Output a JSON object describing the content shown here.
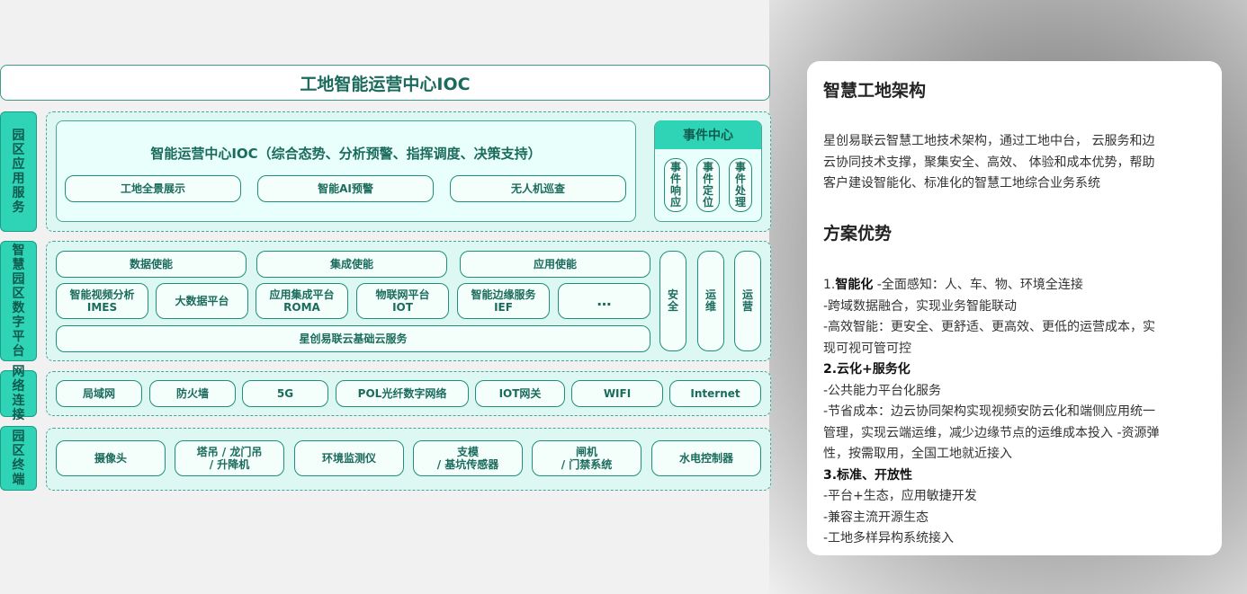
{
  "diagram": {
    "title": "工地智能运营中心IOC",
    "sides": [
      "园区应用服务",
      "智慧园区数字平台",
      "网络连接",
      "园区终端"
    ],
    "app": {
      "heading": "智能运营中心IOC（综合态势、分析预警、指挥调度、决策支持）",
      "items": [
        "工地全景展示",
        "智能AI预警",
        "无人机巡查"
      ],
      "event_center": {
        "title": "事件中心",
        "items": [
          "事件响应",
          "事件定位",
          "事件处理"
        ]
      }
    },
    "platform": {
      "enablers": [
        "数据使能",
        "集成使能",
        "应用使能"
      ],
      "services": [
        {
          "l1": "智能视频分析",
          "l2": "IMES"
        },
        {
          "l1": "大数据平台",
          "l2": ""
        },
        {
          "l1": "应用集成平台",
          "l2": "ROMA"
        },
        {
          "l1": "物联网平台",
          "l2": "IOT"
        },
        {
          "l1": "智能边缘服务",
          "l2": "IEF"
        },
        {
          "l1": "…",
          "l2": ""
        }
      ],
      "base": "星创易联云基础云服务",
      "vertical": [
        "安全",
        "运维",
        "运营"
      ]
    },
    "network": [
      "局域网",
      "防火墙",
      "5G",
      "POL光纤数字网络",
      "IOT网关",
      "WIFI",
      "Internet"
    ],
    "terminals": [
      {
        "l1": "摄像头",
        "l2": ""
      },
      {
        "l1": "塔吊 / 龙门吊",
        "l2": "/ 升降机"
      },
      {
        "l1": "环境监测仪",
        "l2": ""
      },
      {
        "l1": "支模",
        "l2": "/ 基坑传感器"
      },
      {
        "l1": "闸机",
        "l2": "/ 门禁系统"
      },
      {
        "l1": "水电控制器",
        "l2": ""
      }
    ]
  },
  "card": {
    "title": "智慧工地架构",
    "intro": [
      "星创易联云智慧工地技术架构，通过工地中台， 云服务和边",
      "云协同技术支撑，聚集安全、高效、 体验和成本优势，帮助",
      "客户建设智能化、标准化的智慧工地综合业务系统"
    ],
    "adv_title": "方案优势",
    "s1_num": "1.",
    "s1_title": "智能化",
    "s1_tail": " -全面感知：人、车、物、环境全连接",
    "s1_lines": [
      "-跨域数据融合，实现业务智能联动",
      "-高效智能：更安全、更舒适、更高效、更低的运营成本，实",
      "现可视可管可控"
    ],
    "s2_title": "2.云化+服务化",
    "s2_lines": [
      "-公共能力平台化服务",
      "-节省成本：边云协同架构实现视频安防云化和端侧应用统一",
      "管理，实现云端运维，减少边缘节点的运维成本投入 -资源弹",
      "性，按需取用，全国工地就近接入"
    ],
    "s3_title": "3.标准、开放性",
    "s3_lines": [
      "-平台+生态，应用敏捷开发",
      "-兼容主流开源生态",
      "-工地多样异构系统接入"
    ]
  }
}
